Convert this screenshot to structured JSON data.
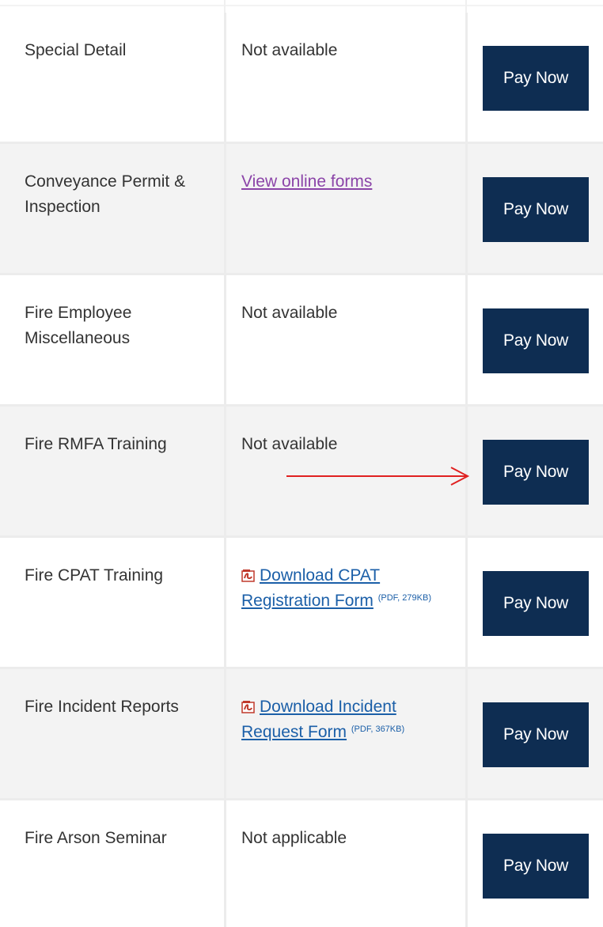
{
  "table": {
    "rows": [
      {
        "name": "Special Detail",
        "form": {
          "type": "text",
          "text": "Not available"
        },
        "pay_label": "Pay Now"
      },
      {
        "name": "Conveyance Permit & Inspection",
        "form": {
          "type": "link",
          "text": "View online forms"
        },
        "pay_label": "Pay Now"
      },
      {
        "name": "Fire Employee Miscellaneous",
        "form": {
          "type": "text",
          "text": "Not available"
        },
        "pay_label": "Pay Now"
      },
      {
        "name": "Fire RMFA Training",
        "form": {
          "type": "text",
          "text": "Not available"
        },
        "pay_label": "Pay Now"
      },
      {
        "name": "Fire CPAT Training",
        "form": {
          "type": "pdf",
          "text": "Download CPAT Registration Form",
          "meta": "(PDF, 279KB)"
        },
        "pay_label": "Pay Now"
      },
      {
        "name": "Fire Incident Reports",
        "form": {
          "type": "pdf",
          "text": "Download Incident Request Form",
          "meta": "(PDF, 367KB)"
        },
        "pay_label": "Pay Now"
      },
      {
        "name": "Fire Arson Seminar",
        "form": {
          "type": "text",
          "text": "Not applicable"
        },
        "pay_label": "Pay Now"
      }
    ]
  },
  "annotation": {
    "icon": "red-arrow-icon",
    "color": "#e02020"
  },
  "colors": {
    "button_bg": "#0e2d52",
    "link": "#1b5fa8",
    "visited_link": "#8b44a8",
    "alt_row": "#f3f3f3"
  }
}
